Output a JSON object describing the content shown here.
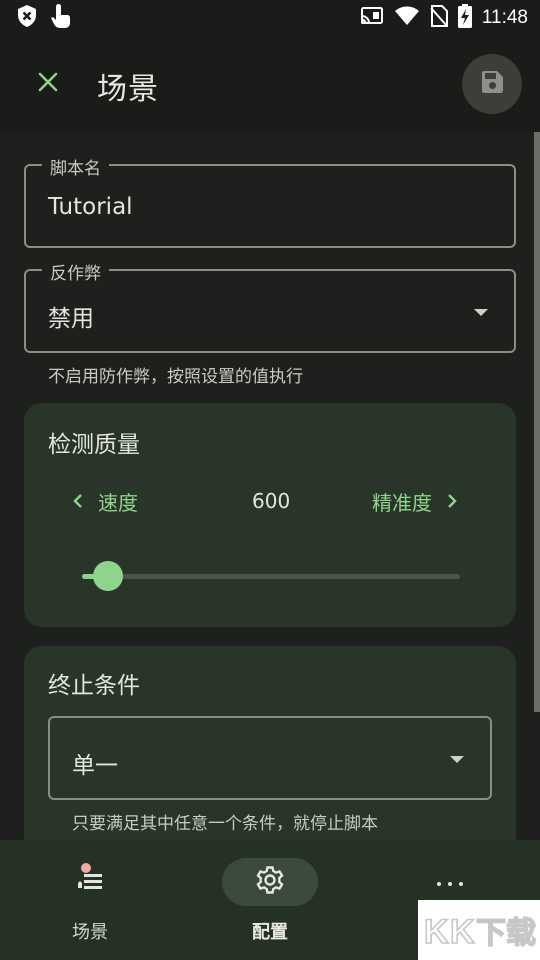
{
  "status": {
    "time": "11:48",
    "icons": [
      "shield-x-icon",
      "touch-icon",
      "cast-icon",
      "wifi-icon",
      "no-sim-icon",
      "battery-charging-icon"
    ]
  },
  "appbar": {
    "title": "场景",
    "close_icon": "close-icon",
    "save_icon": "save-icon"
  },
  "script_name": {
    "label": "脚本名",
    "value": "Tutorial"
  },
  "anti_cheat": {
    "label": "反作弊",
    "value": "禁用",
    "helper": "不启用防作弊，按照设置的值执行"
  },
  "detection_quality": {
    "title": "检测质量",
    "speed_label": "速度",
    "precision_label": "精准度",
    "value": "600",
    "slider_fraction": 0.07
  },
  "stop_condition": {
    "title": "终止条件",
    "value": "单一",
    "helper": "只要满足其中任意一个条件，就停止脚本"
  },
  "bottom_nav": {
    "items": [
      {
        "label": "场景",
        "icon": "scene-list-icon",
        "active": false
      },
      {
        "label": "配置",
        "icon": "gear-icon",
        "active": true
      },
      {
        "label": "",
        "icon": "more-icon",
        "active": false
      }
    ]
  },
  "watermark": "KK下载",
  "colors": {
    "accent": "#8fd48b",
    "background": "#1e201d",
    "card": "#283528",
    "nav": "#263126"
  }
}
